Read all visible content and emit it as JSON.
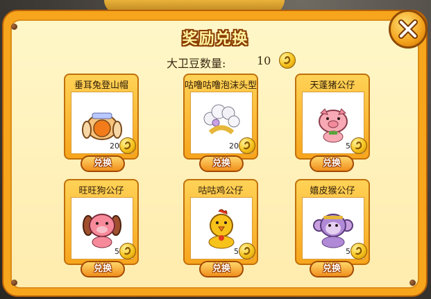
{
  "title": "奖励兑换",
  "currency": {
    "label": "大卫豆数量:",
    "amount": "10",
    "icon": "bean-coin-icon"
  },
  "items": [
    {
      "name": "垂耳兔登山帽",
      "price": "20",
      "button": "兑换",
      "icon": "rabbit-hat-icon"
    },
    {
      "name": "咕噜咕噜泡沫头型",
      "price": "20",
      "button": "兑换",
      "icon": "bubble-hair-icon"
    },
    {
      "name": "天蓬猪公仔",
      "price": "5",
      "button": "兑换",
      "icon": "pig-doll-icon"
    },
    {
      "name": "旺旺狗公仔",
      "price": "5",
      "button": "兑换",
      "icon": "dog-doll-icon"
    },
    {
      "name": "咕咕鸡公仔",
      "price": "5",
      "button": "兑换",
      "icon": "chicken-doll-icon"
    },
    {
      "name": "嬉皮猴公仔",
      "price": "5",
      "button": "兑换",
      "icon": "monkey-doll-icon"
    }
  ],
  "colors": {
    "panel": "#f7a51c",
    "inner": "#fff7c8",
    "button": "#f08f1c"
  }
}
